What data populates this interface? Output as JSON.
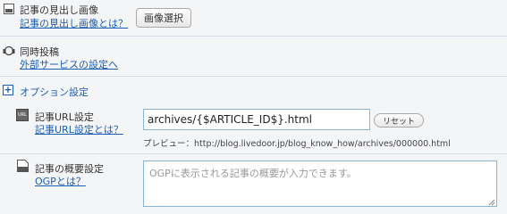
{
  "headline_image": {
    "title": "記事の見出し画像",
    "help_link": "記事の見出し画像とは？",
    "select_button": "画像選択"
  },
  "simultaneous_post": {
    "title": "同時投稿",
    "settings_link": "外部サービスの設定へ"
  },
  "options": {
    "toggle_label": "オプション設定",
    "toggle_glyph": "+"
  },
  "article_url": {
    "title": "記事URL設定",
    "help_link": "記事URL設定とは？",
    "value": "archives/{$ARTICLE_ID$}.html",
    "reset_button": "リセット",
    "preview": "プレビュー：http://blog.livedoor.jp/blog_know_how/archives/000000.html",
    "icon_text": "URL"
  },
  "summary": {
    "title": "記事の概要設定",
    "help_link": "OGPとは？",
    "placeholder": "OGPに表示される記事の概要が入力できます。"
  },
  "colors": {
    "link": "#1a5fb4",
    "border": "#8ab3d8",
    "background": "#f4f5f7"
  }
}
